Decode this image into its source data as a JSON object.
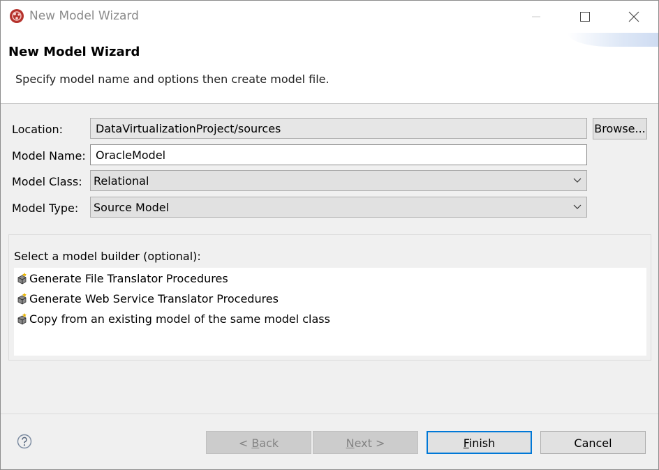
{
  "window": {
    "title": "New Model Wizard",
    "controls": {
      "minimize": "minimize",
      "maximize": "maximize",
      "close": "close"
    }
  },
  "header": {
    "title": "New Model Wizard",
    "description": "Specify model name and options then create model file."
  },
  "form": {
    "location": {
      "label": "Location:",
      "value": "DataVirtualizationProject/sources",
      "browse_label": "Browse..."
    },
    "model_name": {
      "label": "Model Name:",
      "value": "OracleModel"
    },
    "model_class": {
      "label": "Model Class:",
      "selected": "Relational"
    },
    "model_type": {
      "label": "Model Type:",
      "selected": "Source Model"
    }
  },
  "builder": {
    "label": "Select a model builder (optional):",
    "items": [
      {
        "label": "Generate File Translator Procedures",
        "icon": "wizard-icon"
      },
      {
        "label": "Generate Web Service Translator Procedures",
        "icon": "wizard-icon"
      },
      {
        "label": "Copy from an existing model of the same model class",
        "icon": "wizard-icon"
      }
    ]
  },
  "footer": {
    "back": {
      "prefix": "< ",
      "mnemonic": "B",
      "rest": "ack"
    },
    "next": {
      "mnemonic": "N",
      "rest": "ext >"
    },
    "finish": {
      "mnemonic": "F",
      "rest": "inish"
    },
    "cancel": "Cancel"
  },
  "colors": {
    "default_button_border": "#0078d7",
    "dialog_background": "#f0f0f0",
    "disabled_text": "#838383"
  }
}
